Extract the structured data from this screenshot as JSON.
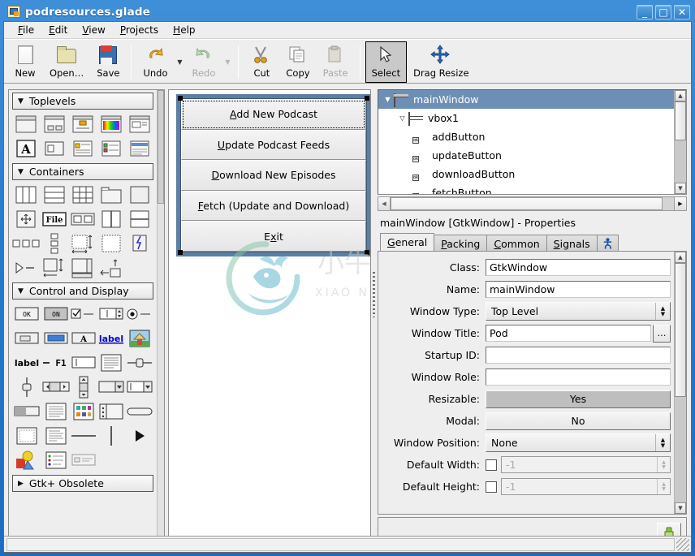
{
  "window": {
    "title": "podresources.glade",
    "icon": "glade-file-icon",
    "buttons": {
      "minimize": "_",
      "maximize": "□",
      "close": "✕"
    }
  },
  "menubar": {
    "items": [
      {
        "label": "File",
        "mnemonic": "F"
      },
      {
        "label": "Edit",
        "mnemonic": "E"
      },
      {
        "label": "View",
        "mnemonic": "V"
      },
      {
        "label": "Projects",
        "mnemonic": "P"
      },
      {
        "label": "Help",
        "mnemonic": "H"
      }
    ]
  },
  "toolbar": {
    "items": [
      {
        "label": "New",
        "icon": "new-document-icon",
        "disabled": false,
        "arrow": false
      },
      {
        "label": "Open…",
        "icon": "open-folder-icon",
        "disabled": false,
        "arrow": false
      },
      {
        "label": "Save",
        "icon": "save-floppy-icon",
        "disabled": false,
        "arrow": false
      },
      {
        "label": "Undo",
        "icon": "undo-arrow-icon",
        "disabled": false,
        "arrow": true
      },
      {
        "label": "Redo",
        "icon": "redo-arrow-icon",
        "disabled": true,
        "arrow": true
      },
      {
        "label": "Cut",
        "icon": "scissors-icon",
        "disabled": false,
        "arrow": false
      },
      {
        "label": "Copy",
        "icon": "copy-pages-icon",
        "disabled": false,
        "arrow": false
      },
      {
        "label": "Paste",
        "icon": "clipboard-icon",
        "disabled": true,
        "arrow": false
      },
      {
        "label": "Select",
        "icon": "cursor-arrow-icon",
        "disabled": false,
        "arrow": false,
        "active": true
      },
      {
        "label": "Drag Resize",
        "icon": "drag-resize-icon",
        "disabled": false,
        "arrow": false
      }
    ]
  },
  "palette": {
    "sections": [
      {
        "name": "Toplevels",
        "expanded": true,
        "rows": 2
      },
      {
        "name": "Containers",
        "expanded": true,
        "rows": 4
      },
      {
        "name": "Control and Display",
        "expanded": true,
        "rows": 7
      },
      {
        "name": "Gtk+ Obsolete",
        "expanded": false,
        "rows": 0
      }
    ]
  },
  "design": {
    "mock_window": {
      "name": "mainWindow",
      "selected": true,
      "buttons": [
        {
          "label": "Add New Podcast",
          "mnemonic": "A",
          "focused": true
        },
        {
          "label": "Update Podcast Feeds",
          "mnemonic": "U",
          "focused": false
        },
        {
          "label": "Download New Episodes",
          "mnemonic": "D",
          "focused": false
        },
        {
          "label": "Fetch (Update and Download)",
          "mnemonic": "F",
          "focused": false
        },
        {
          "label": "Exit",
          "mnemonic": "x",
          "focused": false
        }
      ]
    },
    "watermark": {
      "cn_text": "小牛知识库",
      "pinyin_text": "XIAO NIU ZHI SHI KU"
    }
  },
  "tree": {
    "rows": [
      {
        "label": "mainWindow",
        "indent": 0,
        "expander": "▼",
        "icon": "window-icon",
        "selected": true
      },
      {
        "label": "vbox1",
        "indent": 1,
        "expander": "▽",
        "icon": "vbox-icon",
        "selected": false
      },
      {
        "label": "addButton",
        "indent": 2,
        "expander": "",
        "icon": "button-icon",
        "selected": false
      },
      {
        "label": "updateButton",
        "indent": 2,
        "expander": "",
        "icon": "button-icon",
        "selected": false
      },
      {
        "label": "downloadButton",
        "indent": 2,
        "expander": "",
        "icon": "button-icon",
        "selected": false
      },
      {
        "label": "fetchButton",
        "indent": 2,
        "expander": "",
        "icon": "button-icon",
        "selected": false
      }
    ]
  },
  "properties": {
    "header": "mainWindow [GtkWindow] - Properties",
    "tabs": [
      {
        "label": "General",
        "mnemonic": "G",
        "active": true
      },
      {
        "label": "Packing",
        "mnemonic": "P",
        "active": false
      },
      {
        "label": "Common",
        "mnemonic": "C",
        "active": false
      },
      {
        "label": "Signals",
        "mnemonic": "S",
        "active": false
      },
      {
        "label": "",
        "mnemonic": "",
        "active": false,
        "icon": "accessibility-icon"
      }
    ],
    "rows": [
      {
        "label": "Class:",
        "type": "entry",
        "value": "GtkWindow"
      },
      {
        "label": "Name:",
        "type": "entry",
        "value": "mainWindow"
      },
      {
        "label": "Window Type:",
        "type": "combo",
        "value": "Top Level"
      },
      {
        "label": "Window Title:",
        "type": "entry-ellipsis",
        "value": "Pod",
        "button": "…"
      },
      {
        "label": "Startup ID:",
        "type": "entry",
        "value": ""
      },
      {
        "label": "Window Role:",
        "type": "entry",
        "value": ""
      },
      {
        "label": "Resizable:",
        "type": "toggle",
        "value": "Yes",
        "on": true
      },
      {
        "label": "Modal:",
        "type": "toggle",
        "value": "No",
        "on": false
      },
      {
        "label": "Window Position:",
        "type": "combo",
        "value": "None"
      },
      {
        "label": "Default Width:",
        "type": "check-spin",
        "value": "-1",
        "checked": false
      },
      {
        "label": "Default Height:",
        "type": "check-spin",
        "value": "-1",
        "checked": false
      }
    ]
  },
  "bottom": {
    "clear_button_icon": "paintbrush-icon"
  },
  "statusbar": {
    "text": ""
  },
  "colors": {
    "titlebar": "#2a7bcc",
    "selection": "#6e8fb5",
    "chrome": "#eeeeee",
    "mock_frame": "#5c7fa3"
  }
}
